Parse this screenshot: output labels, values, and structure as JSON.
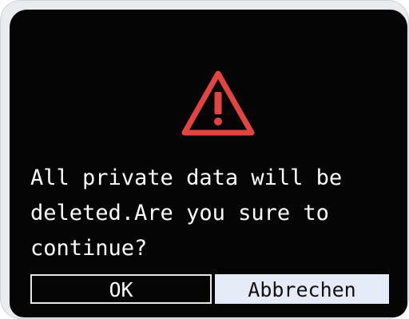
{
  "dialog": {
    "icon": "warning-triangle-icon",
    "message_line1": "All private data will be",
    "message_line2": "deleted.Are you sure to",
    "message_line3": "continue?",
    "ok_label": "OK",
    "cancel_label": "Abbrechen"
  },
  "colors": {
    "screen_background": "#050505",
    "warning": "#e0463f",
    "text": "#ffffff",
    "selected_button": "#e6ecf7"
  }
}
